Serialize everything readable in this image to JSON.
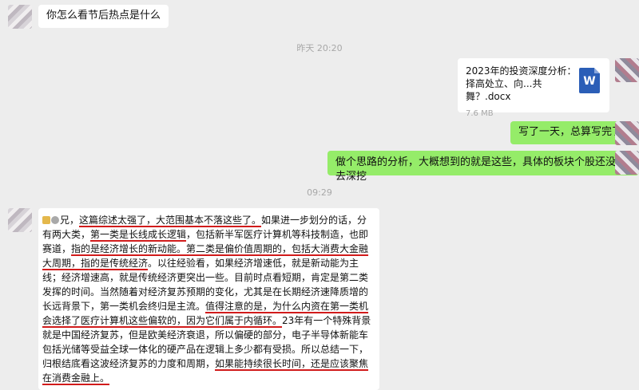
{
  "messages": {
    "msg1": "你怎么看节后热点是什么",
    "ts1": "昨天 20:20",
    "file": {
      "name": "2023年的投资深度分析：择高处立、向...共舞？.docx",
      "size": "7.6 MB",
      "icon_letter": "W"
    },
    "msg2": "写了一天，总算写完了",
    "msg3": "做个思路的分析，大概想到的就是这些，具体的板块个股还没有去深挖",
    "ts2": "09:29",
    "long": {
      "p1": "兄，",
      "p2": "这篇综述太强了，大范围基本不落这些了。",
      "p3": "如果进一步划分的话，分有两大类，",
      "p4": "第一类是长线成长逻辑",
      "p5": "，包括新半军医疗计算机等科技制造，也即赛道，",
      "p6": "指的是经济增长的新动能。",
      "p7": "第二类是偏价值周期的，包括大消费大金融大周期，指的是传统经济",
      "p8": "。以往经验看，如果经济增速低，就是新动能为主线；经济增速高，就是传统经济更突出一些。目前时点看短期，肯定是第二类发挥的时间。当然随着对经济复苏预期的变化，尤其是在长期经济速降质增的长远背景下，第一类机会终归是主流。",
      "p9": "值得注意的是，为什么内资在第一类机会选择了医疗计算机这些偏软的，因为它们属于内循环。",
      "p10": "23年有一个特殊背景就是中国经济复苏，但是欧美经济衰退，所以偏硬的部分，电子半导体新能车包括光储等受益全球一体化的硬产品在逻辑上多少都有受损。所以总结一下，归根结底看这波经济复苏的力度和周期，",
      "p11": "如果能持续很长时间，还是应该聚焦在消费金融上。"
    }
  }
}
